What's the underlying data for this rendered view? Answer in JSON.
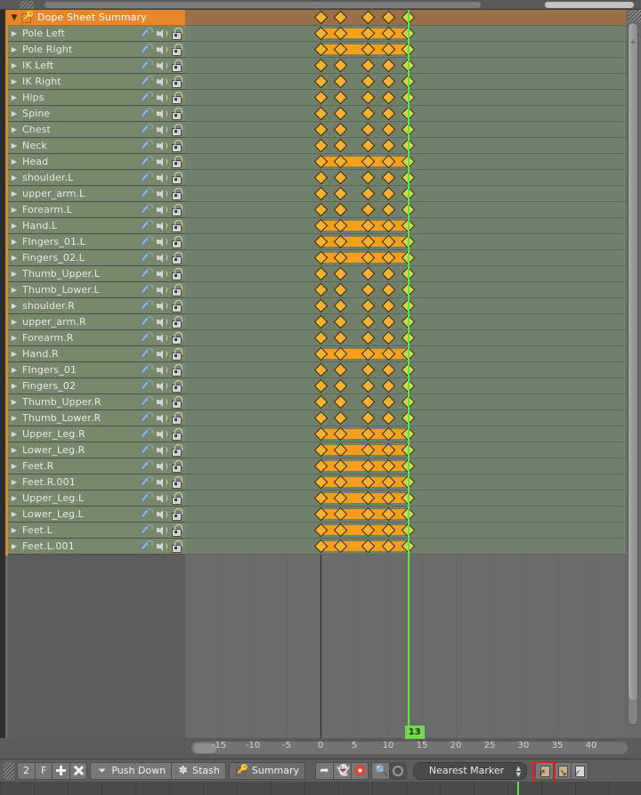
{
  "editor": {
    "name": "Dope Sheet",
    "summary_row": {
      "label": "Dope Sheet Summary",
      "expanded": true,
      "icon": "keyframe-icon"
    },
    "channel_icons": {
      "modifier": "wrench-icon",
      "mute": "speaker-icon",
      "lock": "unlocked-padlock-icon"
    },
    "channels": [
      {
        "label": "Pole Left",
        "holds": true
      },
      {
        "label": "Pole Right",
        "holds": true
      },
      {
        "label": "IK Left",
        "holds": false
      },
      {
        "label": "IK Right",
        "holds": false
      },
      {
        "label": "Hips",
        "holds": false
      },
      {
        "label": "Spine",
        "holds": false
      },
      {
        "label": "Chest",
        "holds": false
      },
      {
        "label": "Neck",
        "holds": false
      },
      {
        "label": "Head",
        "holds": true
      },
      {
        "label": "shoulder.L",
        "holds": false
      },
      {
        "label": "upper_arm.L",
        "holds": false
      },
      {
        "label": "Forearm.L",
        "holds": false
      },
      {
        "label": "Hand.L",
        "holds": true
      },
      {
        "label": "FIngers_01.L",
        "holds": true
      },
      {
        "label": "Fingers_02.L",
        "holds": true
      },
      {
        "label": "Thumb_Upper.L",
        "holds": false
      },
      {
        "label": "Thumb_Lower.L",
        "holds": false
      },
      {
        "label": "shoulder.R",
        "holds": false
      },
      {
        "label": "upper_arm.R",
        "holds": false
      },
      {
        "label": "Forearm.R",
        "holds": false
      },
      {
        "label": "Hand.R",
        "holds": true
      },
      {
        "label": "FIngers_01",
        "holds": false
      },
      {
        "label": "Fingers_02",
        "holds": false
      },
      {
        "label": "Thumb_Upper.R",
        "holds": false
      },
      {
        "label": "Thumb_Lower.R",
        "holds": false
      },
      {
        "label": "Upper_Leg.R",
        "holds": true
      },
      {
        "label": "Lower_Leg.R",
        "holds": true
      },
      {
        "label": "Feet.R",
        "holds": true
      },
      {
        "label": "Feet.R.001",
        "holds": true
      },
      {
        "label": "Upper_Leg.L",
        "holds": true
      },
      {
        "label": "Lower_Leg.L",
        "holds": true
      },
      {
        "label": "Feet.L",
        "holds": true
      },
      {
        "label": "Feet.L.001",
        "holds": true
      }
    ],
    "keyframe_frames": [
      0,
      3,
      7,
      10,
      13
    ],
    "hold_spans": [
      [
        0,
        13
      ]
    ],
    "current_frame": 13,
    "current_frame_label": "13"
  },
  "ruler": {
    "ticks": [
      "-15",
      "-10",
      "-5",
      "0",
      "5",
      "10",
      "15",
      "20",
      "25",
      "30",
      "35",
      "40"
    ],
    "tick_values": [
      -15,
      -10,
      -5,
      0,
      5,
      10,
      15,
      20,
      25,
      30,
      35,
      40
    ],
    "range": [
      -17,
      43
    ]
  },
  "toolbar": {
    "layer_count": "2",
    "fake_user": "F",
    "add_action_icon": "plus-icon",
    "unlink_action_icon": "x-icon",
    "push_down": "Push Down",
    "push_down_icon": "double-chevron-down-icon",
    "stash": "Stash",
    "stash_icon": "asterisk-icon",
    "mode": "Summary",
    "mode_icon": "dope-sheet-icon",
    "select_cursor_icon": "arrow-cursor-icon",
    "ghost_icon": "ghost-icon",
    "proportional_icon": "proportional-edit-icon",
    "magnify_icon": "magnifier-icon",
    "falloff_icon": "circle-falloff-icon",
    "snap_label": "Nearest Marker",
    "copy_icon": "copy-keyframes-icon",
    "paste_icon": "paste-keyframes-icon",
    "paste_flipped_icon": "paste-flipped-icon",
    "highlight_color": "#e02020",
    "highlighted_button": "copy-keyframes-icon"
  },
  "colors": {
    "summary_header": "#e8862a",
    "channel_row": "#77886b",
    "keyframe": "#f3b233",
    "hold_bar": "#f79e1b",
    "playhead": "#6ddb4a",
    "frame_badge": "#73d84b"
  }
}
